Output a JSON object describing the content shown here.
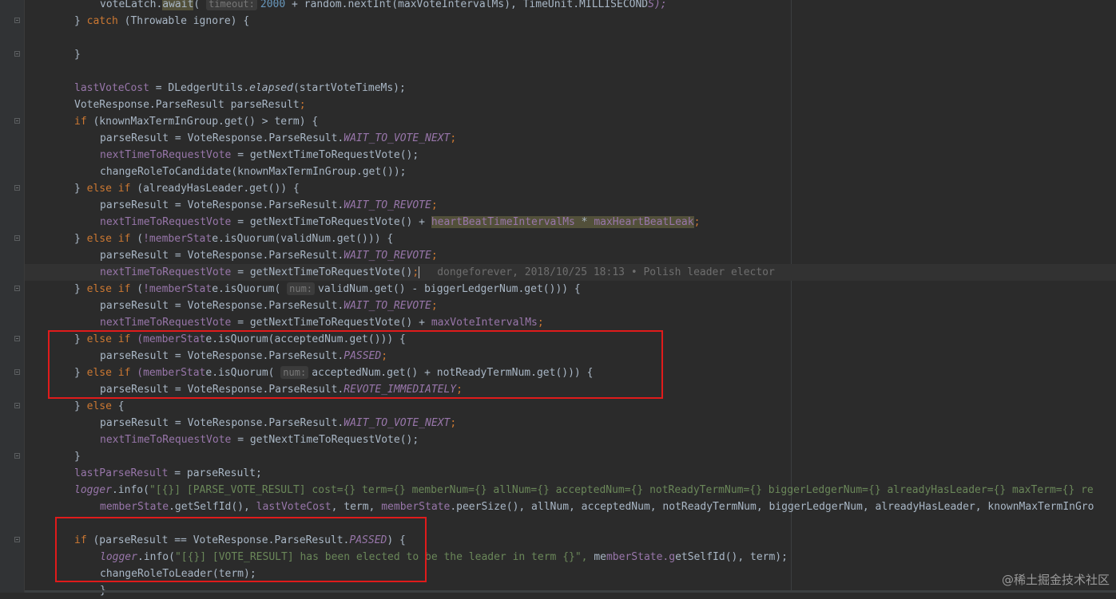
{
  "editor": {
    "lines": [
      "voteLatch.await( timeout: 2000 + random.nextInt(maxVoteIntervalMs), TimeUnit.MILLISECONDS);",
      "} catch (Throwable ignore) {",
      "",
      "}",
      "",
      "lastVoteCost = DLedgerUtils.elapsed(startVoteTimeMs);",
      "VoteResponse.ParseResult parseResult;",
      "if (knownMaxTermInGroup.get() > term) {",
      "parseResult = VoteResponse.ParseResult.WAIT_TO_VOTE_NEXT;",
      "nextTimeToRequestVote = getNextTimeToRequestVote();",
      "changeRoleToCandidate(knownMaxTermInGroup.get());",
      "} else if (alreadyHasLeader.get()) {",
      "parseResult = VoteResponse.ParseResult.WAIT_TO_REVOTE;",
      "nextTimeToRequestVote = getNextTimeToRequestVote() + heartBeatTimeIntervalMs * maxHeartBeatLeak;",
      "} else if (!memberState.isQuorum(validNum.get())) {",
      "parseResult = VoteResponse.ParseResult.WAIT_TO_REVOTE;",
      "nextTimeToRequestVote = getNextTimeToRequestVote();",
      "} else if (!memberState.isQuorum( num: validNum.get() - biggerLedgerNum.get())) {",
      "parseResult = VoteResponse.ParseResult.WAIT_TO_REVOTE;",
      "nextTimeToRequestVote = getNextTimeToRequestVote() + maxVoteIntervalMs;",
      "} else if (memberState.isQuorum(acceptedNum.get())) {",
      "parseResult = VoteResponse.ParseResult.PASSED;",
      "} else if (memberState.isQuorum( num: acceptedNum.get() + notReadyTermNum.get())) {",
      "parseResult = VoteResponse.ParseResult.REVOTE_IMMEDIATELY;",
      "} else {",
      "parseResult = VoteResponse.ParseResult.WAIT_TO_VOTE_NEXT;",
      "nextTimeToRequestVote = getNextTimeToRequestVote();",
      "}",
      "lastParseResult = parseResult;",
      "logger.info(\"[{}] [PARSE_VOTE_RESULT] cost={} term={} memberNum={} allNum={} acceptedNum={} notReadyTermNum={} biggerLedgerNum={} alreadyHasLeader={} maxTerm={} re",
      "memberState.getSelfId(), lastVoteCost, term, memberState.peerSize(), allNum, acceptedNum, notReadyTermNum, biggerLedgerNum, alreadyHasLeader, knownMaxTermInGro",
      "",
      "if (parseResult == VoteResponse.ParseResult.PASSED) {",
      "logger.info(\"[{}] [VOTE_RESULT] has been elected to be the leader in term {}\", memberState.getSelfId(), term);",
      "changeRoleToLeader(term);",
      "}"
    ],
    "blame": "dongeforever, 2018/10/25 18:13 • Polish leader elector"
  },
  "watermark": "@稀土掘金技术社区",
  "colors": {
    "background": "#2b2b2b",
    "keyword": "#cc7832",
    "field": "#9876aa",
    "string": "#6a8759",
    "number": "#6897bb",
    "annotation_box": "#e01b1b"
  }
}
